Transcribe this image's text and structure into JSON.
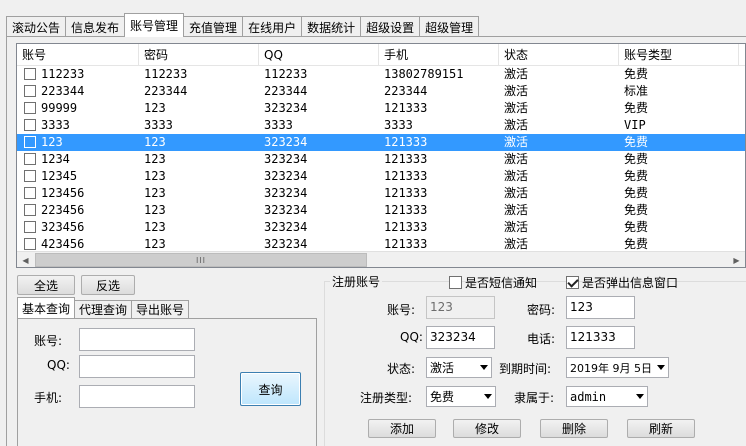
{
  "tabs": [
    "滚动公告",
    "信息发布",
    "账号管理",
    "充值管理",
    "在线用户",
    "数据统计",
    "超级设置",
    "超级管理"
  ],
  "active_tab": 2,
  "table": {
    "columns": [
      "账号",
      "密码",
      "QQ",
      "手机",
      "状态",
      "账号类型"
    ],
    "rows": [
      [
        "112233",
        "112233",
        "112233",
        "13802789151",
        "激活",
        "免费"
      ],
      [
        "223344",
        "223344",
        "223344",
        "223344",
        "激活",
        "标准"
      ],
      [
        "99999",
        "123",
        "323234",
        "121333",
        "激活",
        "免费"
      ],
      [
        "3333",
        "3333",
        "3333",
        "3333",
        "激活",
        "VIP"
      ],
      [
        "123",
        "123",
        "323234",
        "121333",
        "激活",
        "免费"
      ],
      [
        "1234",
        "123",
        "323234",
        "121333",
        "激活",
        "免费"
      ],
      [
        "12345",
        "123",
        "323234",
        "121333",
        "激活",
        "免费"
      ],
      [
        "123456",
        "123",
        "323234",
        "121333",
        "激活",
        "免费"
      ],
      [
        "223456",
        "123",
        "323234",
        "121333",
        "激活",
        "免费"
      ],
      [
        "323456",
        "123",
        "323234",
        "121333",
        "激活",
        "免费"
      ],
      [
        "423456",
        "123",
        "323234",
        "121333",
        "激活",
        "免费"
      ]
    ],
    "selected_row": 4,
    "scroll_grip": "III"
  },
  "buttons": {
    "select_all": "全选",
    "invert": "反选",
    "query": "查询",
    "add": "添加",
    "modify": "修改",
    "delete": "删除",
    "refresh": "刷新"
  },
  "subtabs": [
    "基本查询",
    "代理查询",
    "导出账号"
  ],
  "query": {
    "account_label": "账号:",
    "qq_label": "QQ:",
    "phone_label": "手机:",
    "account_value": "",
    "qq_value": "",
    "phone_value": ""
  },
  "register": {
    "group_title": "注册账号",
    "sms_notify_label": "是否短信通知",
    "sms_notify_checked": false,
    "popup_label": "是否弹出信息窗口",
    "popup_checked": true,
    "account_label": "账号:",
    "account_value": "123",
    "password_label": "密码:",
    "password_value": "123",
    "qq_label": "QQ:",
    "qq_value": "323234",
    "phone_label": "电话:",
    "phone_value": "121333",
    "status_label": "状态:",
    "status_value": "激活",
    "expire_label": "到期时间:",
    "expire_value": "2019年  9月  5日",
    "type_label": "注册类型:",
    "type_value": "免费",
    "belongs_label": "隶属于:",
    "belongs_value": "admin"
  }
}
